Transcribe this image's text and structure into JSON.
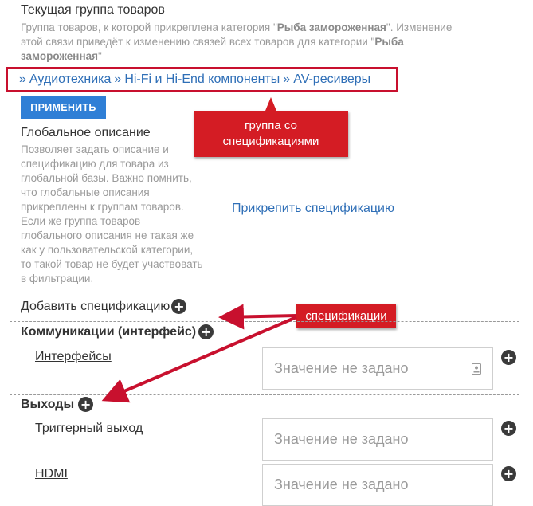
{
  "product_group": {
    "title": "Текущая группа товаров",
    "desc_part1": "Группа товаров, к которой прикреплена категория \"",
    "desc_bold1": "Рыба замороженная",
    "desc_part2": "\". Изменение этой связи приведёт к изменению связей всех товаров для категории \"",
    "desc_bold2": "Рыба замороженная",
    "desc_part3": "\""
  },
  "breadcrumb": {
    "separator": "»",
    "items": [
      "Аудиотехника",
      "Hi-Fi и Hi-End компоненты",
      "AV-ресиверы"
    ]
  },
  "apply_button": "ПРИМЕНИТЬ",
  "callouts": {
    "group": [
      "группа со",
      "спецификациями"
    ],
    "specs": "спецификации"
  },
  "global_description": {
    "title": "Глобальное описание",
    "lines": [
      "Позволяет задать описание и",
      "спецификацию для товара из",
      "глобальной базы. Важно помнить,",
      "что глобальные описания",
      "прикреплены к группам товаров.",
      "Если же группа товаров",
      "глобального описания не такая же",
      "как у пользовательской категории,",
      "то такой товар не будет участвовать",
      "в фильтрации."
    ],
    "attach_link": "Прикрепить спецификацию"
  },
  "add_spec": {
    "label": "Добавить спецификацию",
    "icon": "plus-circle-icon"
  },
  "sections": [
    {
      "title": "Коммуникации (интерфейс)",
      "specs": [
        {
          "name": "Интерфейсы",
          "placeholder": "Значение не задано",
          "icon": "contact-card-icon"
        }
      ]
    },
    {
      "title": "Выходы",
      "specs": [
        {
          "name": "Триггерный выход",
          "placeholder": "Значение не задано"
        },
        {
          "name": "HDMI",
          "placeholder": "Значение не задано"
        }
      ]
    }
  ],
  "colors": {
    "accent": "#c8102e",
    "callout_bg": "#d41c24",
    "link": "#2f6fb7",
    "button": "#2f7fd6"
  }
}
